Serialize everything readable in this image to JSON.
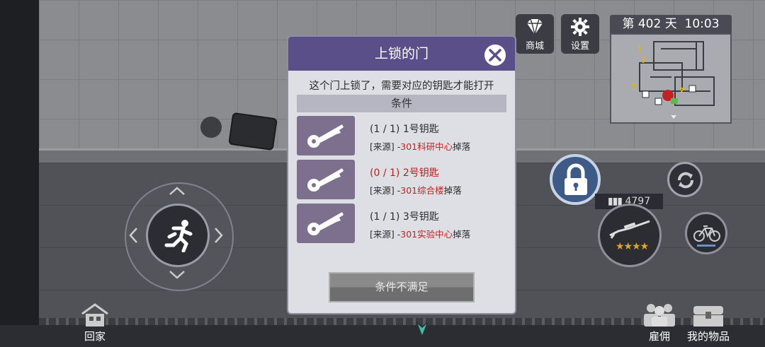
{
  "hud": {
    "shop_label": "商城",
    "settings_label": "设置",
    "day_text": "第 402 天",
    "time_text": "10:03",
    "ammo_count": "4797",
    "home_label": "回家",
    "hire_label": "雇佣",
    "items_label": "我的物品",
    "weapon_stars": 4
  },
  "dialog": {
    "title": "上锁的门",
    "description": "这个门上锁了，需要对应的钥匙才能打开",
    "conditions_header": "条件",
    "requirements": [
      {
        "count": "(1 / 1)",
        "name": "1号钥匙",
        "source_prefix": "[来源] -",
        "source_place": "301科研中心",
        "source_suffix": "掉落",
        "met": true
      },
      {
        "count": "(0 / 1)",
        "name": "2号钥匙",
        "source_prefix": "[来源] -",
        "source_place": "301综合楼",
        "source_suffix": "掉落",
        "met": false
      },
      {
        "count": "(1 / 1)",
        "name": "3号钥匙",
        "source_prefix": "[来源] -",
        "source_place": "301实验中心",
        "source_suffix": "掉落",
        "met": true
      }
    ],
    "action_label": "条件不满足"
  },
  "colors": {
    "header": "#5b4f8a",
    "missing": "#b32222",
    "highlight": "#c22020",
    "key_tile": "#7d708f"
  }
}
